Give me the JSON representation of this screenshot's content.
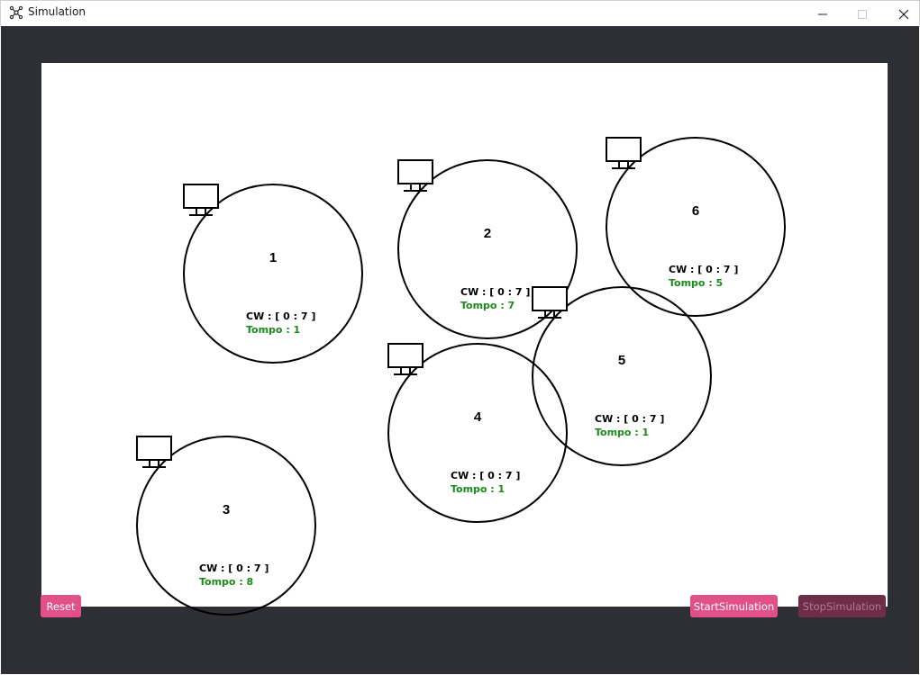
{
  "window": {
    "title": "Simulation",
    "app_icon": "network-icon",
    "controls": [
      "minimize-icon",
      "maximize-icon",
      "close-icon"
    ]
  },
  "nodes": [
    {
      "id": "1",
      "cw": "CW : [ 0 : 7 ]",
      "tempo": "Tompo : 1"
    },
    {
      "id": "2",
      "cw": "CW : [ 0 : 7 ]",
      "tempo": "Tompo : 7"
    },
    {
      "id": "6",
      "cw": "CW : [ 0 : 7 ]",
      "tempo": "Tompo : 5"
    },
    {
      "id": "5",
      "cw": "CW : [ 0 : 7 ]",
      "tempo": "Tompo : 1"
    },
    {
      "id": "4",
      "cw": "CW : [ 0 : 7 ]",
      "tempo": "Tompo : 1"
    },
    {
      "id": "3",
      "cw": "CW : [ 0 : 7 ]",
      "tempo": "Tompo : 8"
    }
  ],
  "buttons": {
    "reset": "Reset",
    "start": "StartSimulation",
    "stop": "StopSimulation"
  },
  "colors": {
    "background": "#2e2e35",
    "canvas": "#ffffff",
    "button_active": "#e2508a",
    "button_disabled": "#6e2e48",
    "tempo_text": "#1a8a1a"
  }
}
